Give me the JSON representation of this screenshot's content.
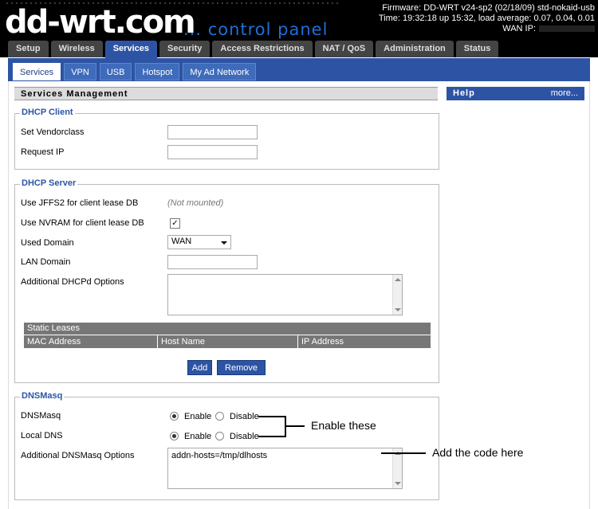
{
  "header": {
    "logo_main": "dd-wrt.com",
    "logo_sub": "... control panel",
    "firmware": "Firmware: DD-WRT v24-sp2 (02/18/09) std-nokaid-usb",
    "time": "Time: 19:32:18 up 15:32, load average: 0.07, 0.04, 0.01",
    "wan_ip_label": "WAN IP:"
  },
  "main_tabs": [
    "Setup",
    "Wireless",
    "Services",
    "Security",
    "Access Restrictions",
    "NAT / QoS",
    "Administration",
    "Status"
  ],
  "sub_tabs": [
    "Services",
    "VPN",
    "USB",
    "Hotspot",
    "My Ad Network"
  ],
  "section_title": "Services Management",
  "help": {
    "title": "Help",
    "more": "more..."
  },
  "dhcp_client": {
    "legend": "DHCP Client",
    "vendorclass_label": "Set Vendorclass",
    "request_ip_label": "Request IP"
  },
  "dhcp_server": {
    "legend": "DHCP Server",
    "jffs2_label": "Use JFFS2 for client lease DB",
    "jffs2_note": "(Not mounted)",
    "nvram_label": "Use NVRAM for client lease DB",
    "nvram_checked": "✓",
    "used_domain_label": "Used Domain",
    "used_domain_value": "WAN",
    "lan_domain_label": "LAN Domain",
    "additional_label": "Additional DHCPd Options",
    "static_leases": "Static Leases",
    "lease_columns": [
      "MAC Address",
      "Host Name",
      "IP Address"
    ],
    "add_button": "Add",
    "remove_button": "Remove"
  },
  "dnsmasq": {
    "legend": "DNSMasq",
    "dnsmasq_label": "DNSMasq",
    "local_dns_label": "Local DNS",
    "enable": "Enable",
    "disable": "Disable",
    "options_label": "Additional DNSMasq Options",
    "options_value": "addn-hosts=/tmp/dlhosts"
  },
  "annotations": {
    "enable_these": "Enable these",
    "add_code": "Add the code here"
  }
}
